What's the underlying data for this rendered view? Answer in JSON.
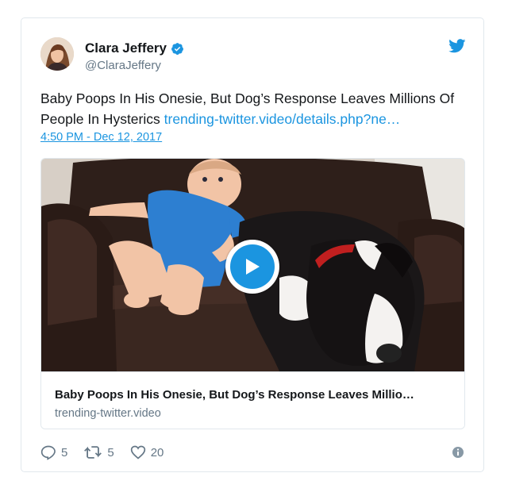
{
  "user": {
    "name": "Clara Jeffery",
    "handle": "@ClaraJeffery"
  },
  "tweet": {
    "text": "Baby Poops In His Onesie, But Dog’s Response Leaves Millions Of People In Hysterics ",
    "link": "trending-twitter.video/details.php?ne…",
    "timestamp": "4:50 PM - Dec 12, 2017"
  },
  "media_card": {
    "title": "Baby Poops In His Onesie, But Dog’s Response Leaves Millio…",
    "domain": "trending-twitter.video"
  },
  "actions": {
    "replies": "5",
    "retweets": "5",
    "likes": "20"
  },
  "colors": {
    "accent": "#1b95e0",
    "secondary_text": "#657786",
    "border": "#e1e8ed"
  }
}
